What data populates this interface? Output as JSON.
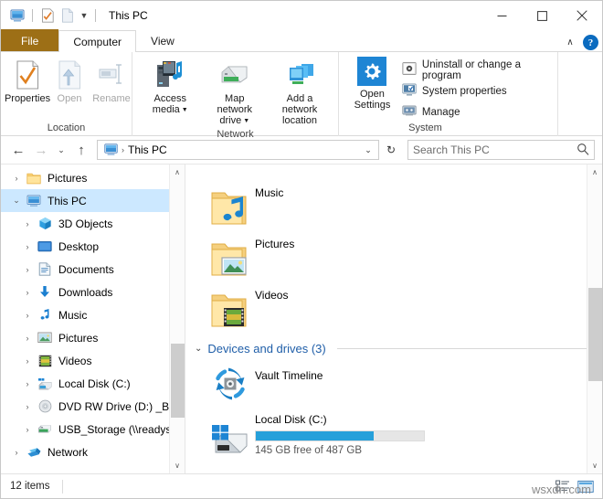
{
  "window": {
    "title": "This PC",
    "quick_access": [
      {
        "name": "this-pc-icon",
        "label": "This PC"
      },
      {
        "name": "properties-icon",
        "label": "Properties"
      },
      {
        "name": "new-folder-icon",
        "label": "New folder"
      },
      {
        "name": "customize-caret",
        "label": "Customize Quick Access Toolbar"
      }
    ],
    "controls": {
      "minimize": "─",
      "maximize": "☐",
      "close": "✕"
    }
  },
  "tabs": [
    {
      "label": "File",
      "type": "file"
    },
    {
      "label": "Computer",
      "type": "active"
    },
    {
      "label": "View",
      "type": "plain"
    }
  ],
  "ribbon": {
    "collapse_chevron": "∧",
    "help_label": "?",
    "groups": [
      {
        "label": "Location",
        "buttons": [
          {
            "label": "Properties",
            "icon": "properties-icon",
            "disabled": false,
            "caret": false
          },
          {
            "label": "Open",
            "icon": "open-icon",
            "disabled": true,
            "caret": false
          },
          {
            "label": "Rename",
            "icon": "rename-icon",
            "disabled": true,
            "caret": false
          }
        ]
      },
      {
        "label": "Network",
        "buttons": [
          {
            "label": "Access media",
            "icon": "access-media-icon",
            "disabled": false,
            "caret": true
          },
          {
            "label": "Map network drive",
            "icon": "map-network-drive-icon",
            "disabled": false,
            "caret": true
          },
          {
            "label": "Add a network location",
            "icon": "add-network-location-icon",
            "disabled": false,
            "caret": false
          }
        ]
      },
      {
        "label": "System",
        "big_button": {
          "label": "Open Settings",
          "icon": "settings-gear-icon"
        },
        "small_buttons": [
          {
            "label": "Uninstall or change a program",
            "icon": "uninstall-program-icon"
          },
          {
            "label": "System properties",
            "icon": "system-properties-icon"
          },
          {
            "label": "Manage",
            "icon": "manage-icon"
          }
        ]
      }
    ]
  },
  "address_bar": {
    "back": "←",
    "forward": "→",
    "recent": "⌄",
    "up": "↑",
    "crumb_icon": "this-pc-icon",
    "crumb_separator": "›",
    "path": "This PC",
    "dropdown_caret": "⌄",
    "refresh": "↻",
    "search_placeholder": "Search This PC",
    "search_value": ""
  },
  "nav_pane": {
    "items": [
      {
        "label": "Pictures",
        "icon": "folder-icon",
        "indent": 1,
        "expandable": true,
        "selected": false
      },
      {
        "label": "This PC",
        "icon": "this-pc-icon",
        "indent": 0,
        "expandable": true,
        "expanded": true,
        "selected": true
      },
      {
        "label": "3D Objects",
        "icon": "3d-objects-icon",
        "indent": 1,
        "expandable": true,
        "selected": false
      },
      {
        "label": "Desktop",
        "icon": "desktop-icon",
        "indent": 1,
        "expandable": true,
        "selected": false
      },
      {
        "label": "Documents",
        "icon": "documents-icon",
        "indent": 1,
        "expandable": true,
        "selected": false
      },
      {
        "label": "Downloads",
        "icon": "downloads-icon",
        "indent": 1,
        "expandable": true,
        "selected": false
      },
      {
        "label": "Music",
        "icon": "music-icon",
        "indent": 1,
        "expandable": true,
        "selected": false
      },
      {
        "label": "Pictures",
        "icon": "pictures-icon",
        "indent": 1,
        "expandable": true,
        "selected": false
      },
      {
        "label": "Videos",
        "icon": "videos-icon",
        "indent": 1,
        "expandable": true,
        "selected": false
      },
      {
        "label": "Local Disk (C:)",
        "icon": "local-disk-icon",
        "indent": 1,
        "expandable": true,
        "selected": false
      },
      {
        "label": "DVD RW Drive (D:) _BGMC_V",
        "icon": "dvd-drive-icon",
        "indent": 1,
        "expandable": true,
        "selected": false
      },
      {
        "label": "USB_Storage (\\\\readyshare)",
        "icon": "usb-storage-icon",
        "indent": 1,
        "expandable": true,
        "selected": false
      },
      {
        "label": "Network",
        "icon": "network-icon",
        "indent": 0,
        "expandable": true,
        "selected": false
      }
    ]
  },
  "content": {
    "folders": [
      {
        "label": "",
        "icon": "downloads-folder-icon",
        "clipped": true
      },
      {
        "label": "Music",
        "icon": "music-folder-icon",
        "clipped": false
      },
      {
        "label": "Pictures",
        "icon": "pictures-folder-icon",
        "clipped": false
      },
      {
        "label": "Videos",
        "icon": "videos-folder-icon",
        "clipped": false
      }
    ],
    "group_header": {
      "chevron": "⌄",
      "label": "Devices and drives (3)"
    },
    "drives": [
      {
        "label": "Vault Timeline",
        "icon": "vault-timeline-icon",
        "has_bar": false
      },
      {
        "label": "Local Disk (C:)",
        "icon": "local-disk-windows-icon",
        "has_bar": true,
        "free_text": "145 GB free of 487 GB",
        "used_percent": 70,
        "bar_color": "#26a0da"
      }
    ]
  },
  "scrollbars": {
    "nav": {
      "up": "∧",
      "down": "∨",
      "thumb_top_pct": 58,
      "thumb_height_pct": 24
    },
    "content": {
      "up": "∧",
      "down": "∨",
      "thumb_top_pct": 40,
      "thumb_height_pct": 30
    }
  },
  "status_bar": {
    "item_count": "12 items",
    "view_buttons": [
      {
        "name": "details-view-button",
        "label": "Details view"
      },
      {
        "name": "large-icons-view-button",
        "label": "Large icons view"
      }
    ],
    "watermark": "wsxdn.com"
  },
  "colors": {
    "file_tab": "#9d6f16",
    "selection": "#cce8ff",
    "accent_blue": "#26a0da",
    "group_header_text": "#1f5ea8",
    "help_blue": "#0b6bbf"
  }
}
